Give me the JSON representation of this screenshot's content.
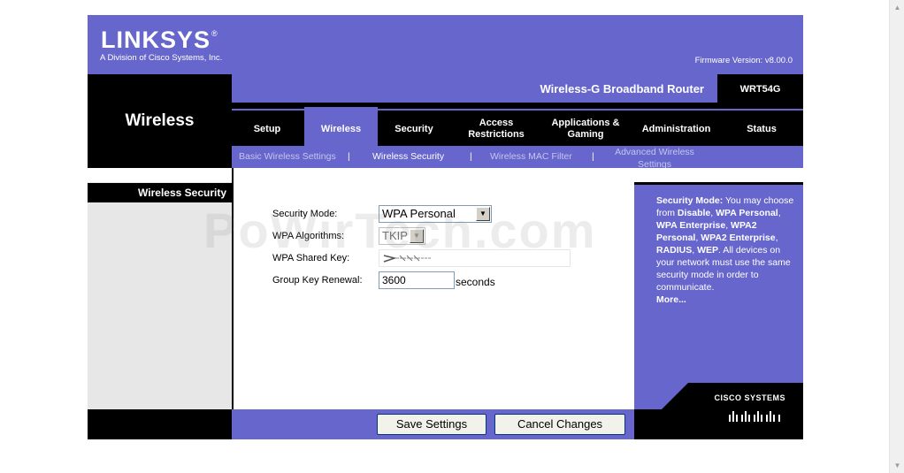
{
  "brand": {
    "logo_text": "LINKSYS",
    "logo_reg": "®",
    "tagline": "A Division of Cisco Systems, Inc.",
    "firmware": "Firmware Version: v8.00.0"
  },
  "header": {
    "section_title": "Wireless",
    "product_name": "Wireless-G Broadband Router",
    "model": "WRT54G"
  },
  "tabs": [
    {
      "label": "Setup"
    },
    {
      "label": "Wireless"
    },
    {
      "label": "Security"
    },
    {
      "label": "Access Restrictions"
    },
    {
      "label": "Applications & Gaming"
    },
    {
      "label": "Administration"
    },
    {
      "label": "Status"
    }
  ],
  "subnav": {
    "items": [
      {
        "label": "Basic Wireless Settings"
      },
      {
        "label": "Wireless Security"
      },
      {
        "label": "Wireless MAC Filter"
      },
      {
        "label": "Advanced Wireless Settings"
      }
    ],
    "separator": "|"
  },
  "left": {
    "title": "Wireless Security"
  },
  "form": {
    "security_mode": {
      "label": "Security Mode:",
      "value": "WPA Personal"
    },
    "wpa_algorithms": {
      "label": "WPA Algorithms:",
      "value": "TKIP"
    },
    "shared_key": {
      "label": "WPA Shared  Key:",
      "value": ""
    },
    "group_key": {
      "label": "Group Key  Renewal:",
      "value": "3600",
      "suffix": "seconds"
    }
  },
  "help": {
    "heading": "Security Mode:",
    "text1": " You may choose from ",
    "opt1": "Disable",
    "opt2": "WPA Personal",
    "opt3": "WPA Enterprise",
    "opt4": "WPA2 Personal",
    "opt5": "WPA2 Enterprise",
    "opt6": "RADIUS",
    "opt7": "WEP",
    "text2": "All devices on your network must use the same security mode in order to communicate.",
    "more": "More..."
  },
  "cisco": {
    "name": "Cisco Systems"
  },
  "buttons": {
    "save": "Save Settings",
    "cancel": "Cancel Changes"
  },
  "watermark": "PoWirTech.com",
  "colors": {
    "brand": "#6666cc",
    "band": "#000000"
  }
}
